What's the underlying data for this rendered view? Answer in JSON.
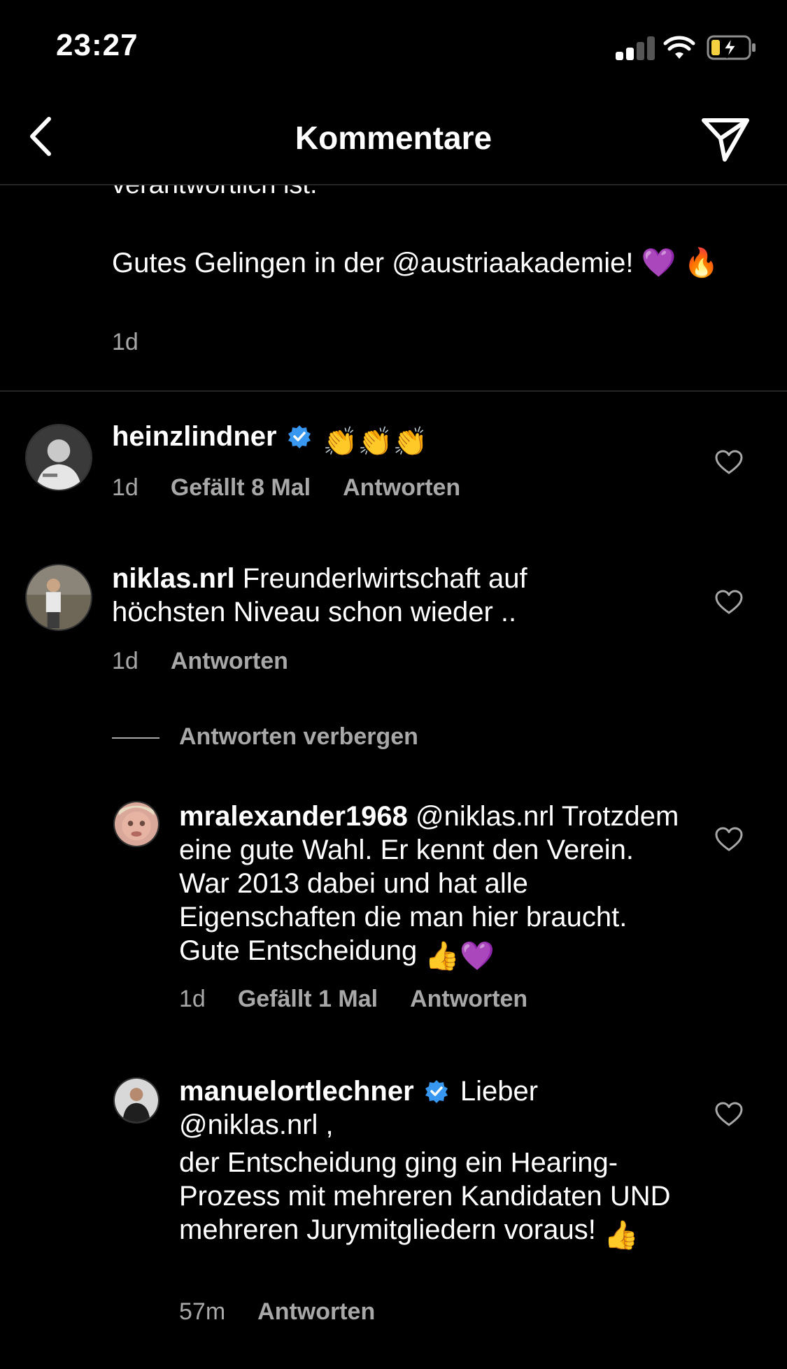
{
  "status_bar": {
    "time": "23:27"
  },
  "header": {
    "title": "Kommentare"
  },
  "caption": {
    "cut_line": "verantwortlich ist.",
    "text": "Gutes Gelingen in der @austriaakademie! 💜 🔥",
    "time": "1d"
  },
  "comments": [
    {
      "username": "heinzlindner",
      "verified": true,
      "text": "👏👏👏",
      "time": "1d",
      "likes": "Gefällt 8 Mal",
      "reply": "Antworten"
    },
    {
      "username": "niklas.nrl",
      "verified": false,
      "text": "Freunderlwirtschaft auf höchsten Niveau schon wieder ..",
      "time": "1d",
      "reply": "Antworten"
    }
  ],
  "hide_replies": "Antworten verbergen",
  "replies": [
    {
      "username": "mralexander1968",
      "verified": false,
      "mention": "@niklas.nrl",
      "text": "Trotzdem eine gute Wahl. Er kennt den Verein. War 2013 dabei und hat alle Eigenschaften die man hier braucht. Gute Entscheidung",
      "emoji": "👍💜",
      "time": "1d",
      "likes": "Gefällt 1 Mal",
      "reply": "Antworten"
    },
    {
      "username": "manuelortlechner",
      "verified": true,
      "greeting": "Lieber",
      "mention": "@niklas.nrl",
      "mention_suffix": " ,",
      "text": "der Entscheidung ging ein Hearing-Prozess mit mehreren Kandidaten UND mehreren Jurymitgliedern voraus!",
      "emoji": "👍",
      "time": "57m",
      "reply": "Antworten"
    }
  ],
  "colors": {
    "background": "#000000",
    "secondary_text": "#a8a8a8",
    "verified_blue": "#3897f0",
    "divider": "#262626"
  },
  "icons": [
    "back-icon",
    "paper-plane-icon",
    "heart-icon",
    "verified-badge-icon",
    "cellular-signal-icon",
    "wifi-icon",
    "battery-charging-icon"
  ]
}
